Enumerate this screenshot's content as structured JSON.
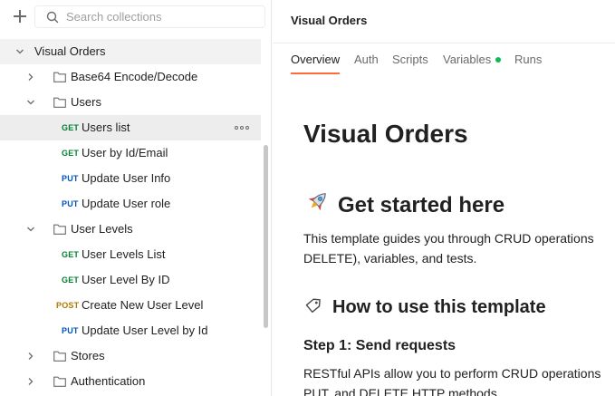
{
  "sidebar": {
    "search": {
      "placeholder": "Search collections",
      "value": ""
    },
    "collection": {
      "name": "Visual Orders"
    },
    "items": [
      {
        "label": "Base64 Encode/Decode"
      },
      {
        "label": "Users"
      },
      {
        "method": "GET",
        "label": "Users list"
      },
      {
        "method": "GET",
        "label": "User by Id/Email"
      },
      {
        "method": "PUT",
        "label": "Update User Info"
      },
      {
        "method": "PUT",
        "label": "Update User role"
      },
      {
        "label": "User Levels"
      },
      {
        "method": "GET",
        "label": "User Levels List"
      },
      {
        "method": "GET",
        "label": "User Level By ID"
      },
      {
        "method": "POST",
        "label": "Create New User Level"
      },
      {
        "method": "PUT",
        "label": "Update User Level by Id"
      },
      {
        "label": "Stores"
      },
      {
        "label": "Authentication"
      }
    ]
  },
  "main": {
    "title": "Visual Orders",
    "tabs": [
      {
        "label": "Overview"
      },
      {
        "label": "Auth"
      },
      {
        "label": "Scripts"
      },
      {
        "label": "Variables"
      },
      {
        "label": "Runs"
      }
    ],
    "doc": {
      "heading": "Visual Orders",
      "section1": {
        "emoji": "🚀",
        "title": "Get started here"
      },
      "para1_line1": "This template guides you through CRUD operations",
      "para1_line2": "DELETE), variables, and tests.",
      "section2": {
        "emoji": "🔖",
        "title": "How to use this template"
      },
      "step1": "Step 1: Send requests",
      "para2_line1": "RESTful APIs allow you to perform CRUD operations",
      "para2_line2": "PUT, and DELETE HTTP methods."
    }
  },
  "colors": {
    "get": "#007f31",
    "put": "#0053b8",
    "post": "#ad7a03",
    "active_tab_underline": "#ff6c37",
    "variables_dot": "#0cbb52"
  }
}
